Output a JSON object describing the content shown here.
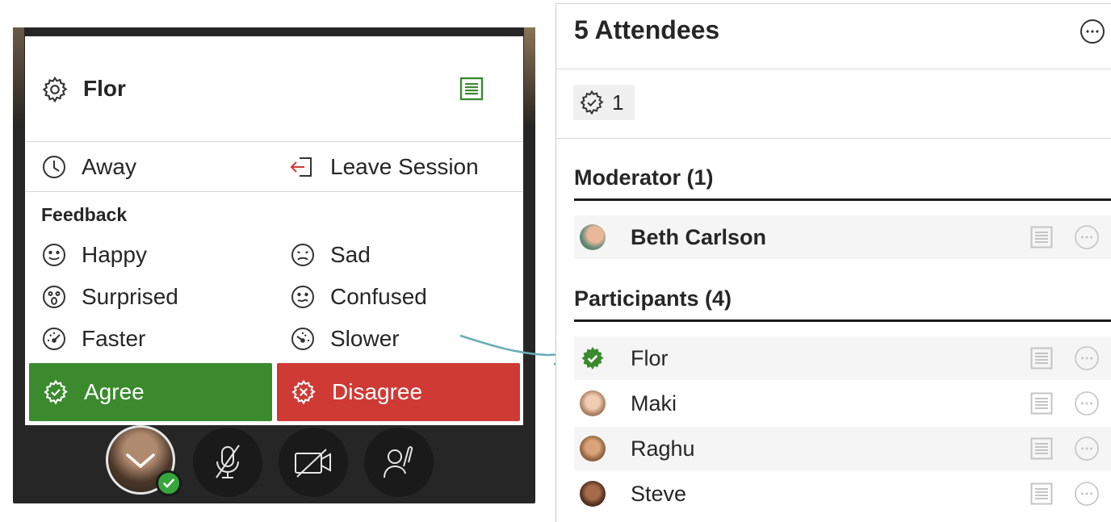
{
  "session_menu": {
    "user_name": "Flor",
    "status_options": {
      "away": "Away",
      "leave": "Leave Session"
    },
    "feedback": {
      "title": "Feedback",
      "options": {
        "happy": "Happy",
        "sad": "Sad",
        "surprised": "Surprised",
        "confused": "Confused",
        "faster": "Faster",
        "slower": "Slower"
      },
      "agree": "Agree",
      "disagree": "Disagree"
    },
    "colors": {
      "agree": "#3b8a2e",
      "disagree": "#cf3a35",
      "notes_icon": "#3b8a2e",
      "leave_icon": "#cf3a35"
    }
  },
  "attendees": {
    "title": "5 Attendees",
    "filter_count": "1",
    "moderators": {
      "title": "Moderator (1)",
      "members": [
        {
          "name": "Beth Carlson"
        }
      ]
    },
    "participants": {
      "title": "Participants (4)",
      "members": [
        {
          "name": "Flor",
          "status": "agree"
        },
        {
          "name": "Maki"
        },
        {
          "name": "Raghu"
        },
        {
          "name": "Steve"
        }
      ]
    }
  }
}
